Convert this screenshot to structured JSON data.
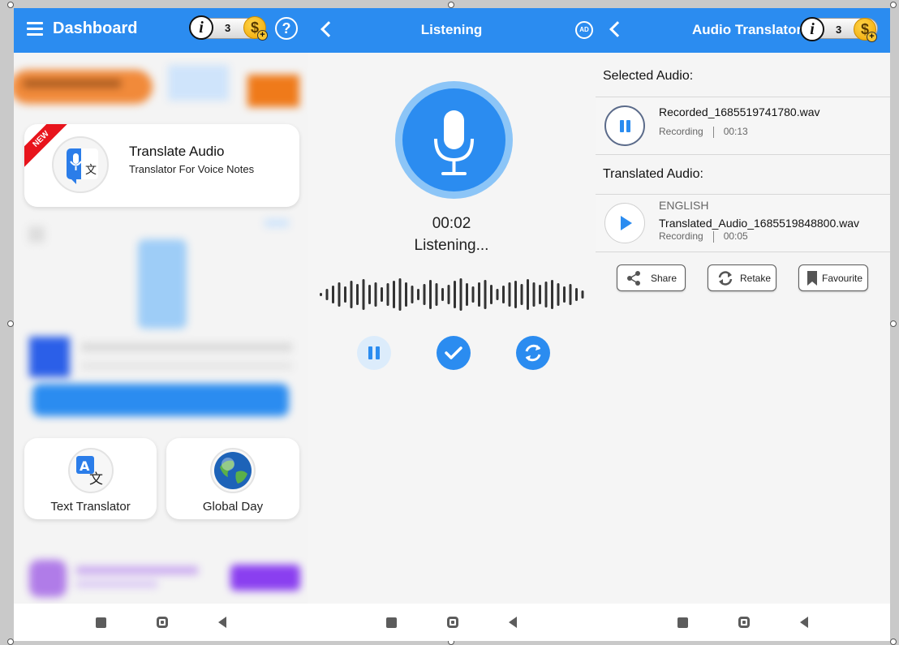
{
  "dashboard": {
    "title": "Dashboard",
    "coins": "3",
    "coin_symbol": "$",
    "info_symbol": "i",
    "help_symbol": "?",
    "new_badge": "NEW",
    "translate_card": {
      "title": "Translate Audio",
      "subtitle": "Translator For Voice Notes"
    },
    "tiles": [
      {
        "label": "Text Translator",
        "icon": "text-translate-icon"
      },
      {
        "label": "Global Day",
        "icon": "globe-icon"
      }
    ]
  },
  "listening": {
    "title": "Listening",
    "ad_label": "AD",
    "timer": "00:02",
    "status": "Listening...",
    "controls": [
      "pause",
      "done",
      "restart"
    ]
  },
  "translator": {
    "title": "Audio Translator",
    "coins": "3",
    "coin_symbol": "$",
    "info_symbol": "i",
    "selected_label": "Selected Audio:",
    "translated_label": "Translated Audio:",
    "selected_audio": {
      "name": "Recorded_1685519741780.wav",
      "type": "Recording",
      "duration": "00:13"
    },
    "translated_audio": {
      "language": "ENGLISH",
      "name": "Translated_Audio_1685519848800.wav",
      "type": "Recording",
      "duration": "00:05"
    },
    "actions": {
      "share": "Share",
      "retake": "Retake",
      "favourite": "Favourite"
    }
  },
  "colors": {
    "primary": "#2b8cf0",
    "primary_light": "#8cc5f7",
    "background": "#f5f5f5",
    "ribbon": "#e8141c",
    "coin": "#f0a500"
  }
}
